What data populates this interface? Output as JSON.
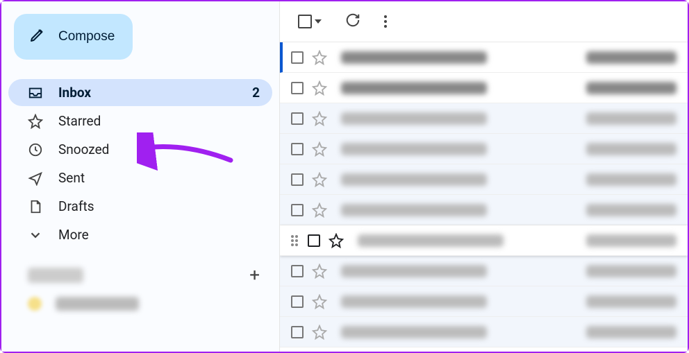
{
  "compose": {
    "label": "Compose"
  },
  "nav": {
    "items": [
      {
        "key": "inbox",
        "label": "Inbox",
        "badge": "2",
        "active": true,
        "icon": "inbox"
      },
      {
        "key": "starred",
        "label": "Starred",
        "icon": "star"
      },
      {
        "key": "snoozed",
        "label": "Snoozed",
        "icon": "clock"
      },
      {
        "key": "sent",
        "label": "Sent",
        "icon": "send"
      },
      {
        "key": "drafts",
        "label": "Drafts",
        "icon": "file"
      },
      {
        "key": "more",
        "label": "More",
        "icon": "chevron-down"
      }
    ]
  },
  "labels": {
    "heading": "Labels",
    "plus": "+",
    "items": [
      {
        "name": "(label)"
      }
    ]
  },
  "toolbar": {
    "select_all": "Select",
    "refresh": "Refresh",
    "more": "More"
  },
  "emails": [
    {
      "unread": true,
      "active": true
    },
    {
      "unread": true
    },
    {
      "unread": false
    },
    {
      "unread": false
    },
    {
      "unread": false
    },
    {
      "unread": false
    },
    {
      "unread": false,
      "hover": true
    },
    {
      "unread": false
    },
    {
      "unread": false
    },
    {
      "unread": false
    }
  ],
  "annotation": {
    "target": "snoozed"
  }
}
